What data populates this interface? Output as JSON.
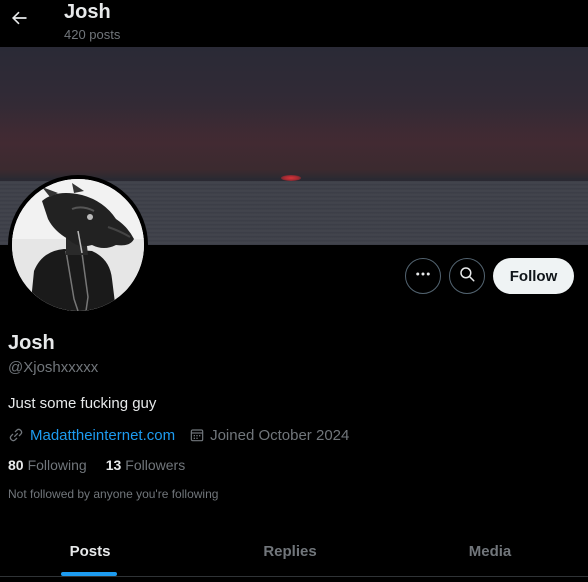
{
  "header": {
    "name": "Josh",
    "posts_count": "420 posts"
  },
  "profile": {
    "display_name": "Josh",
    "handle": "@Xjoshxxxxx",
    "bio": "Just some fucking guy",
    "website": "Madattheinternet.com",
    "joined": "Joined October 2024",
    "following_count": "80",
    "following_label": "Following",
    "followers_count": "13",
    "followers_label": "Followers",
    "not_followed_note": "Not followed by anyone you're following"
  },
  "actions": {
    "follow_label": "Follow"
  },
  "tabs": [
    {
      "label": "Posts",
      "active": true
    },
    {
      "label": "Replies",
      "active": false
    },
    {
      "label": "Media",
      "active": false
    }
  ],
  "colors": {
    "background": "#000000",
    "accent": "#1d9bf0",
    "text_primary": "#e7e9ea",
    "text_secondary": "#71767b",
    "follow_button_bg": "#eff3f4"
  },
  "icons": {
    "back": "arrow-left-icon",
    "more": "more-dots-icon",
    "search": "search-icon",
    "link": "link-icon",
    "calendar": "calendar-icon"
  }
}
